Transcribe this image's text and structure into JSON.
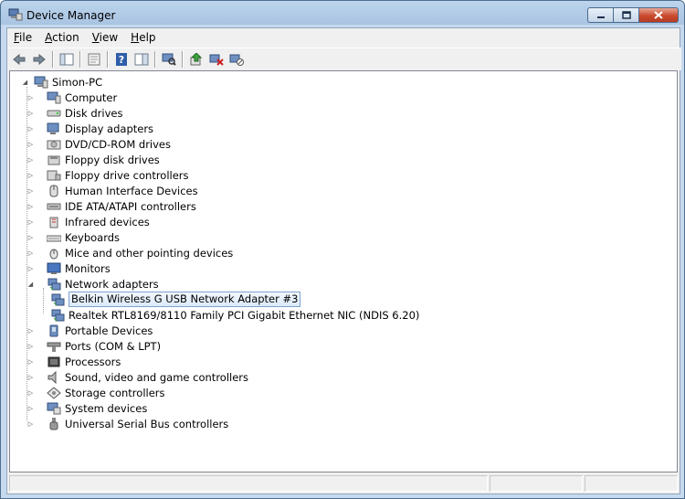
{
  "window": {
    "title": "Device Manager"
  },
  "menubar": {
    "items": [
      {
        "label": "File",
        "accel": "F",
        "rest": "ile"
      },
      {
        "label": "Action",
        "accel": "A",
        "rest": "ction"
      },
      {
        "label": "View",
        "accel": "V",
        "rest": "iew"
      },
      {
        "label": "Help",
        "accel": "H",
        "rest": "elp"
      }
    ]
  },
  "toolbar": {
    "buttons": [
      "back-arrow-icon",
      "forward-arrow-icon",
      "show-hide-console-tree-icon",
      "properties-icon",
      "help-icon",
      "action-pane-icon",
      "scan-hardware-icon",
      "update-driver-icon",
      "uninstall-icon",
      "disable-icon"
    ]
  },
  "tree": {
    "root": "Simon-PC",
    "categories": [
      "Computer",
      "Disk drives",
      "Display adapters",
      "DVD/CD-ROM drives",
      "Floppy disk drives",
      "Floppy drive controllers",
      "Human Interface Devices",
      "IDE ATA/ATAPI controllers",
      "Infrared devices",
      "Keyboards",
      "Mice and other pointing devices",
      "Monitors",
      "Network adapters",
      "Portable Devices",
      "Ports (COM & LPT)",
      "Processors",
      "Sound, video and game controllers",
      "Storage controllers",
      "System devices",
      "Universal Serial Bus controllers"
    ],
    "network_children": [
      "Belkin Wireless G USB Network Adapter #3",
      "Realtek RTL8169/8110 Family PCI Gigabit Ethernet NIC (NDIS 6.20)"
    ],
    "selected": "Belkin Wireless G USB Network Adapter #3"
  },
  "colors": {
    "selection_border": "#7da2ce",
    "title_close": "#c94a2e"
  }
}
